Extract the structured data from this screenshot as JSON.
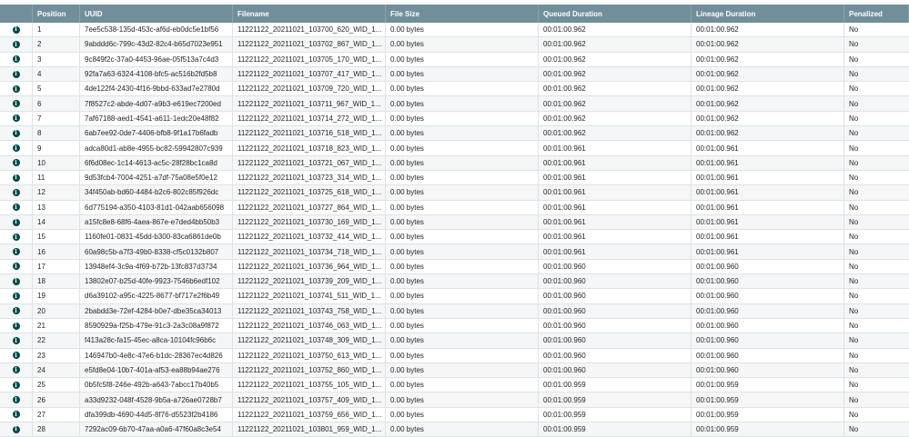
{
  "columns": {
    "position": "Position",
    "uuid": "UUID",
    "filename": "Filename",
    "file_size": "File Size",
    "queued_duration": "Queued Duration",
    "lineage_duration": "Lineage Duration",
    "penalized": "Penalized"
  },
  "icons": {
    "info": "info-icon",
    "info_glyph": "i"
  },
  "colors": {
    "header_bg": "#728e9b",
    "icon": "#004849",
    "row_alt": "#f4f6f7"
  },
  "rows": [
    {
      "position": "1",
      "uuid": "7ee5c538-135d-453c-af6d-eb0dc5e1bf56",
      "filename": "11221122_20211021_103700_620_WID_1...",
      "file_size": "0.00 bytes",
      "queued_duration": "00:01:00.962",
      "lineage_duration": "00:01:00.962",
      "penalized": "No"
    },
    {
      "position": "2",
      "uuid": "9abddd6c-799c-43d2-82c4-b65d7023e951",
      "filename": "11221122_20211021_103702_867_WID_1...",
      "file_size": "0.00 bytes",
      "queued_duration": "00:01:00.962",
      "lineage_duration": "00:01:00.962",
      "penalized": "No"
    },
    {
      "position": "3",
      "uuid": "9c849f2c-37a0-4453-96ae-05f513a7c4d3",
      "filename": "11221122_20211021_103705_170_WID_1...",
      "file_size": "0.00 bytes",
      "queued_duration": "00:01:00.962",
      "lineage_duration": "00:01:00.962",
      "penalized": "No"
    },
    {
      "position": "4",
      "uuid": "92fa7a63-6324-4108-bfc5-ac516b2fd5b8",
      "filename": "11221122_20211021_103707_417_WID_1...",
      "file_size": "0.00 bytes",
      "queued_duration": "00:01:00.962",
      "lineage_duration": "00:01:00.962",
      "penalized": "No"
    },
    {
      "position": "5",
      "uuid": "4de122f4-2430-4f16-9bbd-633ad7e2780d",
      "filename": "11221122_20211021_103709_720_WID_1...",
      "file_size": "0.00 bytes",
      "queued_duration": "00:01:00.962",
      "lineage_duration": "00:01:00.962",
      "penalized": "No"
    },
    {
      "position": "6",
      "uuid": "7f8527c2-abde-4d07-a9b3-e619ec7200ed",
      "filename": "11221122_20211021_103711_967_WID_1...",
      "file_size": "0.00 bytes",
      "queued_duration": "00:01:00.962",
      "lineage_duration": "00:01:00.962",
      "penalized": "No"
    },
    {
      "position": "7",
      "uuid": "7af67188-aed1-4541-a611-1edc20e48f82",
      "filename": "11221122_20211021_103714_272_WID_1...",
      "file_size": "0.00 bytes",
      "queued_duration": "00:01:00.962",
      "lineage_duration": "00:01:00.962",
      "penalized": "No"
    },
    {
      "position": "8",
      "uuid": "6ab7ee92-0de7-4406-bfb8-9f1a17b6fadb",
      "filename": "11221122_20211021_103716_518_WID_1...",
      "file_size": "0.00 bytes",
      "queued_duration": "00:01:00.962",
      "lineage_duration": "00:01:00.962",
      "penalized": "No"
    },
    {
      "position": "9",
      "uuid": "adca80d1-ab8e-4955-bc82-59942807c939",
      "filename": "11221122_20211021_103718_823_WID_1...",
      "file_size": "0.00 bytes",
      "queued_duration": "00:01:00.961",
      "lineage_duration": "00:01:00.961",
      "penalized": "No"
    },
    {
      "position": "10",
      "uuid": "6f6d08ec-1c14-4613-ac5c-28f28bc1ca8d",
      "filename": "11221122_20211021_103721_067_WID_1...",
      "file_size": "0.00 bytes",
      "queued_duration": "00:01:00.961",
      "lineage_duration": "00:01:00.961",
      "penalized": "No"
    },
    {
      "position": "11",
      "uuid": "9d53fcb4-7004-4251-a7df-75a08e5f0e12",
      "filename": "11221122_20211021_103723_314_WID_1...",
      "file_size": "0.00 bytes",
      "queued_duration": "00:01:00.961",
      "lineage_duration": "00:01:00.961",
      "penalized": "No"
    },
    {
      "position": "12",
      "uuid": "34f450ab-bd60-4484-b2c6-802c85f926dc",
      "filename": "11221122_20211021_103725_618_WID_1...",
      "file_size": "0.00 bytes",
      "queued_duration": "00:01:00.961",
      "lineage_duration": "00:01:00.961",
      "penalized": "No"
    },
    {
      "position": "13",
      "uuid": "6d775194-a350-4103-81d1-042aab656098",
      "filename": "11221122_20211021_103727_864_WID_1...",
      "file_size": "0.00 bytes",
      "queued_duration": "00:01:00.961",
      "lineage_duration": "00:01:00.961",
      "penalized": "No"
    },
    {
      "position": "14",
      "uuid": "a15fc8e8-68f6-4aea-867e-e7ded4bb50b3",
      "filename": "11221122_20211021_103730_169_WID_1...",
      "file_size": "0.00 bytes",
      "queued_duration": "00:01:00.961",
      "lineage_duration": "00:01:00.961",
      "penalized": "No"
    },
    {
      "position": "15",
      "uuid": "1160fe01-0831-45dd-b300-83ca6861de0b",
      "filename": "11221122_20211021_103732_414_WID_1...",
      "file_size": "0.00 bytes",
      "queued_duration": "00:01:00.961",
      "lineage_duration": "00:01:00.961",
      "penalized": "No"
    },
    {
      "position": "16",
      "uuid": "60a98c5b-a7f3-49b0-8338-cf5c0132b807",
      "filename": "11221122_20211021_103734_718_WID_1...",
      "file_size": "0.00 bytes",
      "queued_duration": "00:01:00.961",
      "lineage_duration": "00:01:00.961",
      "penalized": "No"
    },
    {
      "position": "17",
      "uuid": "13948ef4-3c9a-4f69-b72b-13fc837d3734",
      "filename": "11221122_20211021_103736_964_WID_1...",
      "file_size": "0.00 bytes",
      "queued_duration": "00:01:00.960",
      "lineage_duration": "00:01:00.960",
      "penalized": "No"
    },
    {
      "position": "18",
      "uuid": "13802e07-b25d-40fe-9923-7546b6edf102",
      "filename": "11221122_20211021_103739_209_WID_1...",
      "file_size": "0.00 bytes",
      "queued_duration": "00:01:00.960",
      "lineage_duration": "00:01:00.960",
      "penalized": "No"
    },
    {
      "position": "19",
      "uuid": "d6a39102-a95c-4225-8677-bf717e2f6b49",
      "filename": "11221122_20211021_103741_511_WID_1...",
      "file_size": "0.00 bytes",
      "queued_duration": "00:01:00.960",
      "lineage_duration": "00:01:00.960",
      "penalized": "No"
    },
    {
      "position": "20",
      "uuid": "2babdd3e-72ef-4284-b0e7-dbe35ca34013",
      "filename": "11221122_20211021_103743_758_WID_1...",
      "file_size": "0.00 bytes",
      "queued_duration": "00:01:00.960",
      "lineage_duration": "00:01:00.960",
      "penalized": "No"
    },
    {
      "position": "21",
      "uuid": "8590929a-f25b-479e-91c3-2a3c08a9f872",
      "filename": "11221122_20211021_103746_063_WID_1...",
      "file_size": "0.00 bytes",
      "queued_duration": "00:01:00.960",
      "lineage_duration": "00:01:00.960",
      "penalized": "No"
    },
    {
      "position": "22",
      "uuid": "f413a28c-fa15-45ec-a8ca-10104fc96b6c",
      "filename": "11221122_20211021_103748_309_WID_1...",
      "file_size": "0.00 bytes",
      "queued_duration": "00:01:00.960",
      "lineage_duration": "00:01:00.960",
      "penalized": "No"
    },
    {
      "position": "23",
      "uuid": "146947b0-4e8c-47e6-b1dc-28367ec4d826",
      "filename": "11221122_20211021_103750_613_WID_1...",
      "file_size": "0.00 bytes",
      "queued_duration": "00:01:00.960",
      "lineage_duration": "00:01:00.960",
      "penalized": "No"
    },
    {
      "position": "24",
      "uuid": "e5fd8e04-10b7-401a-af53-ea88b94ae276",
      "filename": "11221122_20211021_103752_860_WID_1...",
      "file_size": "0.00 bytes",
      "queued_duration": "00:01:00.960",
      "lineage_duration": "00:01:00.960",
      "penalized": "No"
    },
    {
      "position": "25",
      "uuid": "0b5fc5f8-246e-492b-a643-7abcc17b40b5",
      "filename": "11221122_20211021_103755_105_WID_1...",
      "file_size": "0.00 bytes",
      "queued_duration": "00:01:00.959",
      "lineage_duration": "00:01:00.959",
      "penalized": "No"
    },
    {
      "position": "26",
      "uuid": "a33d9232-048f-4528-9b5a-a726ae0728b7",
      "filename": "11221122_20211021_103757_409_WID_1...",
      "file_size": "0.00 bytes",
      "queued_duration": "00:01:00.959",
      "lineage_duration": "00:01:00.959",
      "penalized": "No"
    },
    {
      "position": "27",
      "uuid": "dfa399db-4690-44d5-8f76-d5523f2b4186",
      "filename": "11221122_20211021_103759_656_WID_1...",
      "file_size": "0.00 bytes",
      "queued_duration": "00:01:00.959",
      "lineage_duration": "00:01:00.959",
      "penalized": "No"
    },
    {
      "position": "28",
      "uuid": "7292ac09-6b70-47aa-a0a6-47f60a8c3e54",
      "filename": "11221122_20211021_103801_959_WID_1...",
      "file_size": "0.00 bytes",
      "queued_duration": "00:01:00.959",
      "lineage_duration": "00:01:00.959",
      "penalized": "No"
    }
  ]
}
